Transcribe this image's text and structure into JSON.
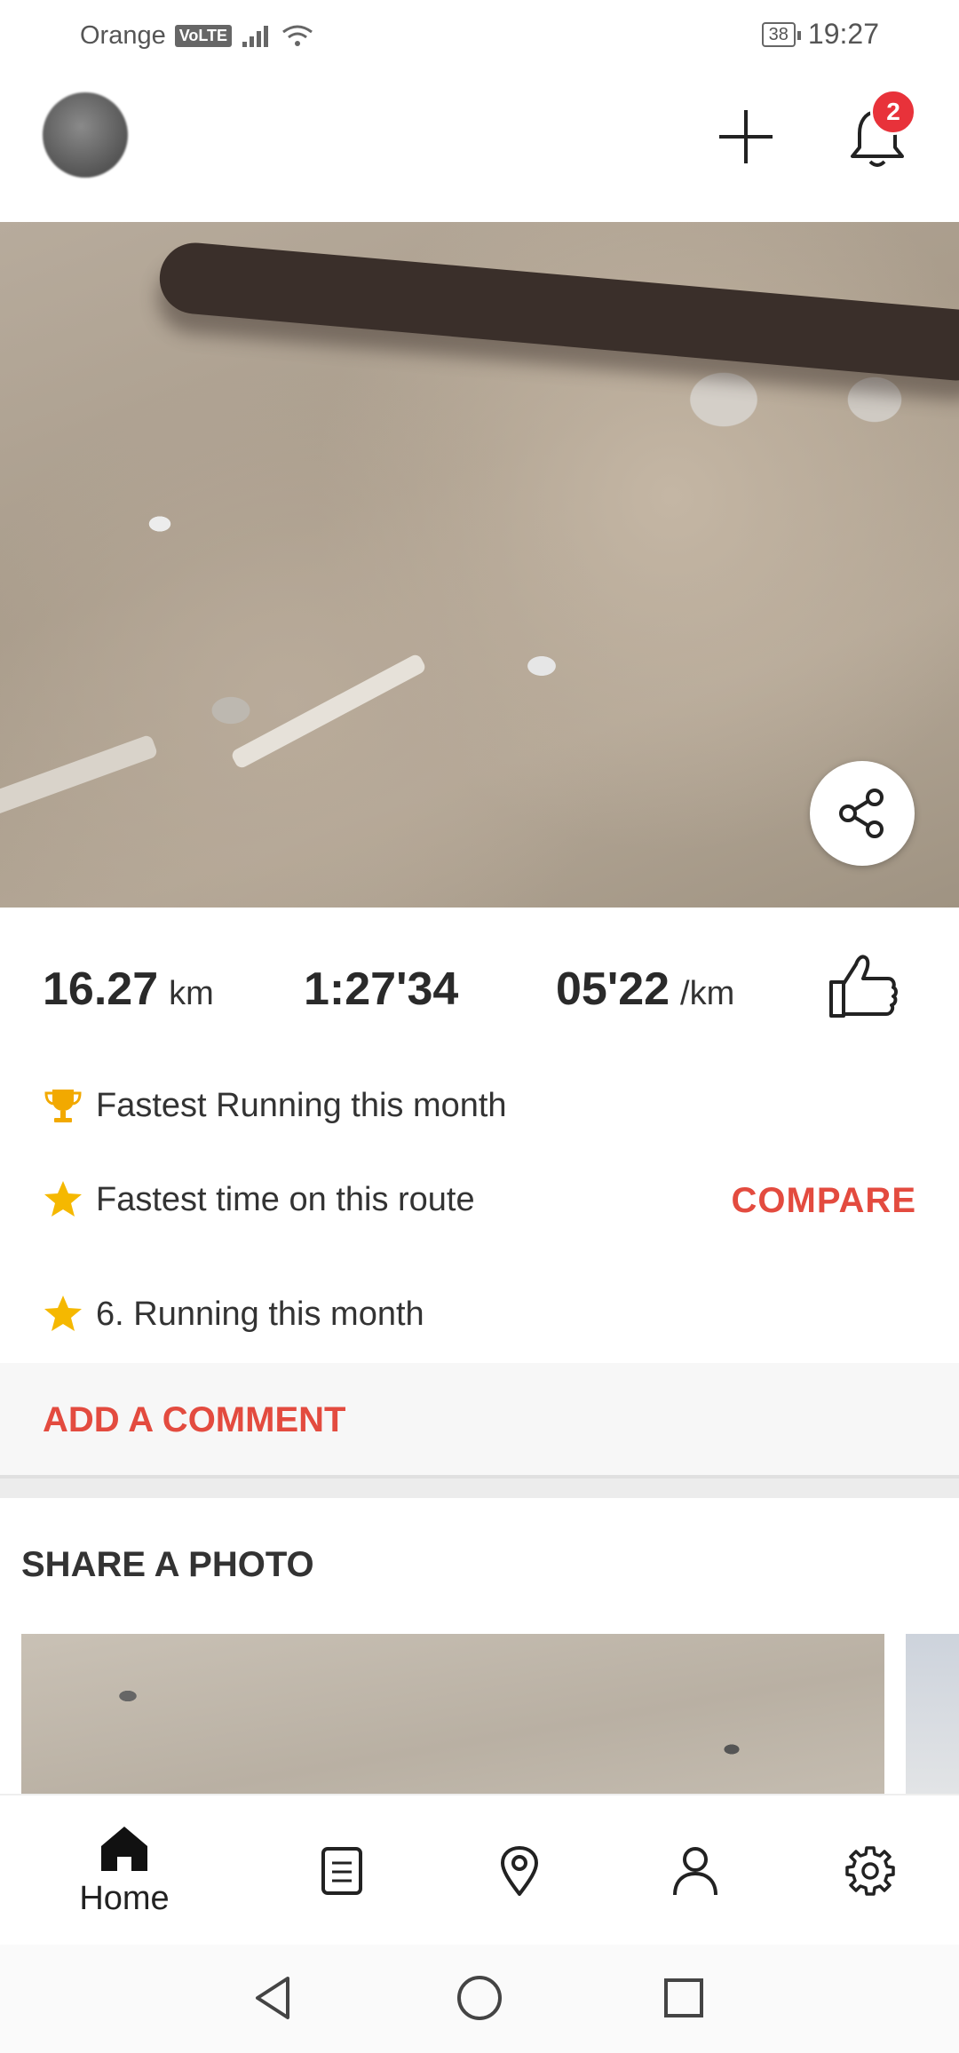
{
  "status_bar": {
    "carrier": "Orange",
    "volte": "VoLTE",
    "battery": "38",
    "time": "19:27"
  },
  "header": {
    "notification_count": "2",
    "icons": [
      "avatar",
      "plus-icon",
      "bell-icon"
    ]
  },
  "activity": {
    "distance_value": "16.27",
    "distance_unit": "km",
    "duration": "1:27'34",
    "pace_value": "05'22",
    "pace_unit": "/km"
  },
  "achievements": [
    {
      "icon": "trophy-icon",
      "text": "Fastest Running this month"
    },
    {
      "icon": "star-icon",
      "text": "Fastest time on this route"
    },
    {
      "icon": "star-icon",
      "text": "6. Running this month"
    }
  ],
  "compare_label": "COMPARE",
  "comment_label": "ADD A COMMENT",
  "share_photo_title": "SHARE A PHOTO",
  "bottom_nav": {
    "home_label": "Home",
    "items": [
      "home-icon",
      "list-icon",
      "map-pin-icon",
      "profile-icon",
      "gear-icon"
    ]
  },
  "colors": {
    "accent": "#e34b3f",
    "badge": "#e8323a",
    "trophy": "#f2a900",
    "star": "#f5b800"
  }
}
